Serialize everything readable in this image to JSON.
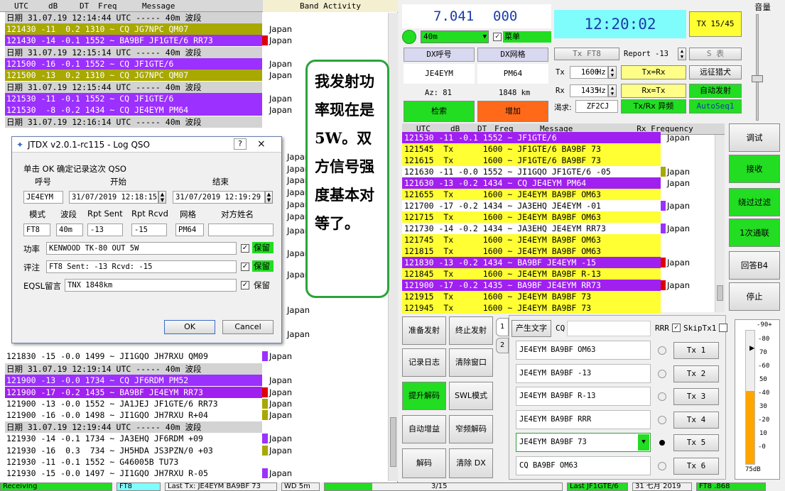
{
  "band": {
    "header": {
      "utc": "UTC",
      "db": "dB",
      "dt": "DT",
      "freq": "Freq",
      "message": "Message",
      "title": "Band Activity"
    },
    "rows": [
      {
        "t": "日期 31.07.19 12:14:44 UTC ----- 40m 波段",
        "c": "",
        "s": "r-sep",
        "m": ""
      },
      {
        "t": "121430 -11  0.2 1310 ~ CQ JG7NPC QM07",
        "c": "Japan",
        "s": "r-olive",
        "m": ""
      },
      {
        "t": "121430 -14 -0.1 1552 ~ BA9BF JF1GTE/6 RR73",
        "c": "Japan",
        "s": "r-purple",
        "m": "m-red"
      },
      {
        "t": "日期 31.07.19 12:15:14 UTC ----- 40m 波段",
        "c": "",
        "s": "r-sep",
        "m": ""
      },
      {
        "t": "121500 -16 -0.1 1552 ~ CQ JF1GTE/6",
        "c": "Japan",
        "s": "r-purple",
        "m": ""
      },
      {
        "t": "121500 -13  0.2 1310 ~ CQ JG7NPC QM07",
        "c": "Japan",
        "s": "r-olive",
        "m": ""
      },
      {
        "t": "日期 31.07.19 12:15:44 UTC ----- 40m 波段",
        "c": "",
        "s": "r-sep",
        "m": ""
      },
      {
        "t": "121530 -11 -0.1 1552 ~ CQ JF1GTE/6",
        "c": "Japan",
        "s": "r-purple",
        "m": ""
      },
      {
        "t": "121530  -8 -0.2 1434 ~ CQ JE4EYM PM64",
        "c": "Japan",
        "s": "r-purple",
        "m": ""
      },
      {
        "t": "日期 31.07.19 12:16:14 UTC ----- 40m 波段",
        "c": "",
        "s": "r-sep",
        "m": ""
      },
      {
        "t": "121830 -15 -0.0 1499 ~ JI1GQO JH7RXU QM09",
        "c": "Japan",
        "s": "r-white",
        "m": "m-purple"
      },
      {
        "t": "日期 31.07.19 12:19:14 UTC ----- 40m 波段",
        "c": "",
        "s": "r-sep",
        "m": ""
      },
      {
        "t": "121900 -13 -0.0 1734 ~ CQ JF6RDM PM52",
        "c": "Japan",
        "s": "r-purple",
        "m": ""
      },
      {
        "t": "121900 -17 -0.2 1435 ~ BA9BF JE4EYM RR73",
        "c": "Japan",
        "s": "r-purple2",
        "m": "m-red"
      },
      {
        "t": "121900 -13 -0.0 1552 ~ JA1JEJ JF1GTE/6 RR73",
        "c": "Japan",
        "s": "r-white",
        "m": "m-olive"
      },
      {
        "t": "121900 -16 -0.0 1498 ~ JI1GQO JH7RXU R+04",
        "c": "Japan",
        "s": "r-white",
        "m": "m-olive"
      },
      {
        "t": "日期 31.07.19 12:19:44 UTC ----- 40m 波段",
        "c": "",
        "s": "r-sep",
        "m": ""
      },
      {
        "t": "121930 -14 -0.1 1734 ~ JA3EHQ JF6RDM +09",
        "c": "Japan",
        "s": "r-white",
        "m": "m-purple"
      },
      {
        "t": "121930 -16  0.3  734 ~ JH5HDA JS3PZN/0 +03",
        "c": "Japan",
        "s": "r-white",
        "m": "m-olive"
      },
      {
        "t": "121930 -11 -0.1 1552 ~ G46005B TU73",
        "c": "",
        "s": "r-white",
        "m": ""
      },
      {
        "t": "121930 -15 -0.0 1497 ~ JI1GQO JH7RXU R-05",
        "c": "Japan",
        "s": "r-white",
        "m": "m-purple"
      }
    ],
    "hidden_cty": [
      "Japan",
      "Japan",
      "Japan",
      "Japan",
      "Japan",
      "Japan",
      "Japan",
      "Japan",
      "Japan",
      "Japan",
      "Japan"
    ]
  },
  "note": {
    "text": "我发射功率现在是5W。双方信号强度基本对等了。"
  },
  "dialog": {
    "title": "JTDX v2.0.1-rc115 - Log QSO",
    "help": "?",
    "close": "×",
    "prompt": "单击 OK 确定记录这次 QSO",
    "callsign_label": "呼号",
    "start_label": "开始",
    "end_label": "结束",
    "callsign": "JE4EYM",
    "start": "31/07/2019 12:18:15",
    "end": "31/07/2019 12:19:29",
    "mode_label": "模式",
    "band_label": "波段",
    "rpt_sent_label": "Rpt Sent",
    "rpt_rcvd_label": "Rpt Rcvd",
    "grid_label": "网格",
    "name_label": "对方姓名",
    "mode": "FT8",
    "band": "40m",
    "rpt_sent": "-13",
    "rpt_rcvd": "-15",
    "grid": "PM64",
    "name": "",
    "power_label": "功率",
    "power": "KENWOOD TK-80 OUT 5W",
    "comment_label": "评注",
    "comment": "FT8  Sent: -13  Rcvd: -15",
    "eqsl_label": "EQSL留言",
    "eqsl": "TNX      1848km",
    "keep": "保留",
    "ok": "OK",
    "cancel": "Cancel"
  },
  "top": {
    "freq_mhz": "7.041",
    "freq_khz": "000",
    "clock": "12:20:02",
    "tx_count": "TX 15/45",
    "band": "40m",
    "menu": "菜单",
    "dx_call_label": "DX呼号",
    "dx_grid_label": "DX网格",
    "dx_call": "JE4EYM",
    "dx_grid": "PM64",
    "az": "Az: 81",
    "dist": "1848 km",
    "lookup": "检索",
    "add": "增加",
    "tx_mode": "Tx FT8",
    "report_label": "Report",
    "report": "-13",
    "s_table": "S 表",
    "tx_label": "Tx",
    "tx_hz": "1600",
    "hz": "Hz",
    "tx_eq_rx": "Tx=Rx",
    "hunt": "远征猎犬",
    "rx_label": "Rx",
    "rx_hz": "1435",
    "rx_eq_tx": "Rx=Tx",
    "auto_tx": "自动发射",
    "want_label": "渴求:",
    "want": "ZF2CJ",
    "txrx_split": "Tx/Rx 异频",
    "autoseq": "AutoSeq1",
    "volume": "音量"
  },
  "rx": {
    "header": {
      "utc": "UTC",
      "db": "dB",
      "dt": "DT",
      "freq": "Freq",
      "message": "Message",
      "title": "Rx Frequency"
    },
    "rows": [
      {
        "t": "121530 -11 -0.1 1552 ~ JF1GTE/6",
        "c": "Japan",
        "s": "p",
        "m": ""
      },
      {
        "t": "121545  Tx      1600 ~ JF1GTE/6 BA9BF 73",
        "c": "",
        "s": "y",
        "m": ""
      },
      {
        "t": "121615  Tx      1600 ~ JF1GTE/6 BA9BF 73",
        "c": "",
        "s": "y",
        "m": ""
      },
      {
        "t": "121630 -11 -0.0 1552 ~ JI1GQO JF1GTE/6 -05",
        "c": "Japan",
        "s": "w",
        "m": "m-olive"
      },
      {
        "t": "121630 -13 -0.2 1434 ~ CQ JE4EYM PM64",
        "c": "Japan",
        "s": "p",
        "m": ""
      },
      {
        "t": "121655  Tx      1600 ~ JE4EYM BA9BF OM63",
        "c": "",
        "s": "y",
        "m": ""
      },
      {
        "t": "121700 -17 -0.2 1434 ~ JA3EHQ JE4EYM -01",
        "c": "Japan",
        "s": "w",
        "m": "m-purple"
      },
      {
        "t": "121715  Tx      1600 ~ JE4EYM BA9BF OM63",
        "c": "",
        "s": "y",
        "m": ""
      },
      {
        "t": "121730 -14 -0.2 1434 ~ JA3EHQ JE4EYM RR73",
        "c": "Japan",
        "s": "w",
        "m": "m-purple"
      },
      {
        "t": "121745  Tx      1600 ~ JE4EYM BA9BF OM63",
        "c": "",
        "s": "y",
        "m": ""
      },
      {
        "t": "121815  Tx      1600 ~ JE4EYM BA9BF OM63",
        "c": "",
        "s": "y",
        "m": ""
      },
      {
        "t": "121830 -13 -0.2 1434 ~ BA9BF JE4EYM -15",
        "c": "Japan",
        "s": "p",
        "m": "m-red"
      },
      {
        "t": "121845  Tx      1600 ~ JE4EYM BA9BF R-13",
        "c": "",
        "s": "y",
        "m": ""
      },
      {
        "t": "121900 -17 -0.2 1435 ~ BA9BF JE4EYM RR73",
        "c": "Japan",
        "s": "p",
        "m": "m-red"
      },
      {
        "t": "121915  Tx      1600 ~ JE4EYM BA9BF 73",
        "c": "",
        "s": "y",
        "m": ""
      },
      {
        "t": "121945  Tx      1600 ~ JE4EYM BA9BF 73",
        "c": "",
        "s": "y",
        "m": ""
      }
    ]
  },
  "controls": {
    "prepare_tx": "准备发射",
    "stop_tx": "终止发射",
    "log": "记录日志",
    "clear_window": "清除窗口",
    "boost": "提升解码",
    "swl": "SWL模式",
    "auto_gain": "自动增益",
    "narrow": "窄频解码",
    "decode": "解码",
    "clear_dx": "清除 DX",
    "tab1": "1",
    "tab2": "2",
    "gen_text": "产生文字",
    "cq": "CQ",
    "rrr": "RRR",
    "skip": "SkipTx1",
    "tx_msgs": [
      "JE4EYM BA9BF OM63",
      "JE4EYM BA9BF -13",
      "JE4EYM BA9BF R-13",
      "JE4EYM BA9BF RRR",
      "JE4EYM BA9BF 73",
      "CQ BA9BF OM63"
    ],
    "tx_btns": [
      "Tx 1",
      "Tx 2",
      "Tx 3",
      "Tx 4",
      "Tx 5",
      "Tx 6"
    ],
    "side": [
      "调试",
      "接收",
      "绕过过滤",
      "1次通联",
      "回答B4",
      "停止"
    ],
    "meter_top": "-90+",
    "meter_ticks": [
      "-80",
      "-60",
      "-40",
      "-20",
      "-0"
    ],
    "meter_ticks_right": [
      "70",
      "50",
      "30",
      "10"
    ],
    "meter_bottom": "75dB",
    "meter_level": 0.55
  },
  "status": {
    "s1": "Receiving",
    "s2": "FT8",
    "s3": "Last Tx: JE4EYM BA9BF 73",
    "s4": "WD 5m",
    "s5": "3/15",
    "s6": "Last JF1GTE/6",
    "s7": "31 七月 2019",
    "s8": "FT8 .868"
  }
}
